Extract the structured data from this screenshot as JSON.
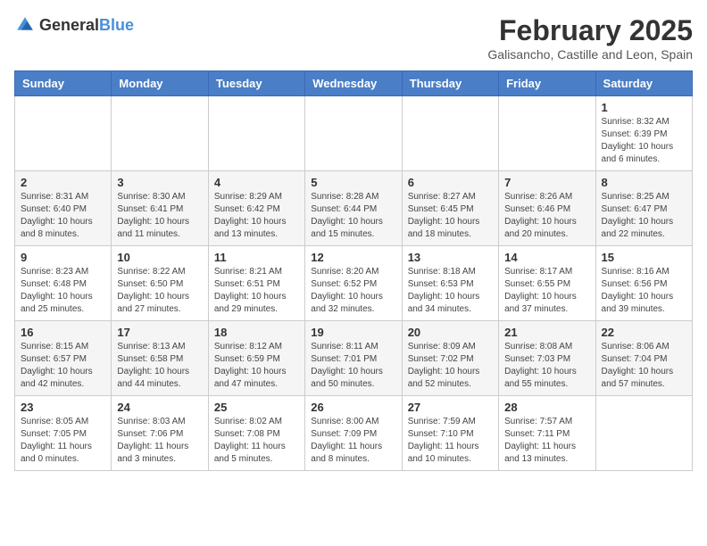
{
  "header": {
    "logo_general": "General",
    "logo_blue": "Blue",
    "month_year": "February 2025",
    "location": "Galisancho, Castille and Leon, Spain"
  },
  "days_of_week": [
    "Sunday",
    "Monday",
    "Tuesday",
    "Wednesday",
    "Thursday",
    "Friday",
    "Saturday"
  ],
  "weeks": [
    [
      {
        "day": "",
        "info": ""
      },
      {
        "day": "",
        "info": ""
      },
      {
        "day": "",
        "info": ""
      },
      {
        "day": "",
        "info": ""
      },
      {
        "day": "",
        "info": ""
      },
      {
        "day": "",
        "info": ""
      },
      {
        "day": "1",
        "info": "Sunrise: 8:32 AM\nSunset: 6:39 PM\nDaylight: 10 hours and 6 minutes."
      }
    ],
    [
      {
        "day": "2",
        "info": "Sunrise: 8:31 AM\nSunset: 6:40 PM\nDaylight: 10 hours and 8 minutes."
      },
      {
        "day": "3",
        "info": "Sunrise: 8:30 AM\nSunset: 6:41 PM\nDaylight: 10 hours and 11 minutes."
      },
      {
        "day": "4",
        "info": "Sunrise: 8:29 AM\nSunset: 6:42 PM\nDaylight: 10 hours and 13 minutes."
      },
      {
        "day": "5",
        "info": "Sunrise: 8:28 AM\nSunset: 6:44 PM\nDaylight: 10 hours and 15 minutes."
      },
      {
        "day": "6",
        "info": "Sunrise: 8:27 AM\nSunset: 6:45 PM\nDaylight: 10 hours and 18 minutes."
      },
      {
        "day": "7",
        "info": "Sunrise: 8:26 AM\nSunset: 6:46 PM\nDaylight: 10 hours and 20 minutes."
      },
      {
        "day": "8",
        "info": "Sunrise: 8:25 AM\nSunset: 6:47 PM\nDaylight: 10 hours and 22 minutes."
      }
    ],
    [
      {
        "day": "9",
        "info": "Sunrise: 8:23 AM\nSunset: 6:48 PM\nDaylight: 10 hours and 25 minutes."
      },
      {
        "day": "10",
        "info": "Sunrise: 8:22 AM\nSunset: 6:50 PM\nDaylight: 10 hours and 27 minutes."
      },
      {
        "day": "11",
        "info": "Sunrise: 8:21 AM\nSunset: 6:51 PM\nDaylight: 10 hours and 29 minutes."
      },
      {
        "day": "12",
        "info": "Sunrise: 8:20 AM\nSunset: 6:52 PM\nDaylight: 10 hours and 32 minutes."
      },
      {
        "day": "13",
        "info": "Sunrise: 8:18 AM\nSunset: 6:53 PM\nDaylight: 10 hours and 34 minutes."
      },
      {
        "day": "14",
        "info": "Sunrise: 8:17 AM\nSunset: 6:55 PM\nDaylight: 10 hours and 37 minutes."
      },
      {
        "day": "15",
        "info": "Sunrise: 8:16 AM\nSunset: 6:56 PM\nDaylight: 10 hours and 39 minutes."
      }
    ],
    [
      {
        "day": "16",
        "info": "Sunrise: 8:15 AM\nSunset: 6:57 PM\nDaylight: 10 hours and 42 minutes."
      },
      {
        "day": "17",
        "info": "Sunrise: 8:13 AM\nSunset: 6:58 PM\nDaylight: 10 hours and 44 minutes."
      },
      {
        "day": "18",
        "info": "Sunrise: 8:12 AM\nSunset: 6:59 PM\nDaylight: 10 hours and 47 minutes."
      },
      {
        "day": "19",
        "info": "Sunrise: 8:11 AM\nSunset: 7:01 PM\nDaylight: 10 hours and 50 minutes."
      },
      {
        "day": "20",
        "info": "Sunrise: 8:09 AM\nSunset: 7:02 PM\nDaylight: 10 hours and 52 minutes."
      },
      {
        "day": "21",
        "info": "Sunrise: 8:08 AM\nSunset: 7:03 PM\nDaylight: 10 hours and 55 minutes."
      },
      {
        "day": "22",
        "info": "Sunrise: 8:06 AM\nSunset: 7:04 PM\nDaylight: 10 hours and 57 minutes."
      }
    ],
    [
      {
        "day": "23",
        "info": "Sunrise: 8:05 AM\nSunset: 7:05 PM\nDaylight: 11 hours and 0 minutes."
      },
      {
        "day": "24",
        "info": "Sunrise: 8:03 AM\nSunset: 7:06 PM\nDaylight: 11 hours and 3 minutes."
      },
      {
        "day": "25",
        "info": "Sunrise: 8:02 AM\nSunset: 7:08 PM\nDaylight: 11 hours and 5 minutes."
      },
      {
        "day": "26",
        "info": "Sunrise: 8:00 AM\nSunset: 7:09 PM\nDaylight: 11 hours and 8 minutes."
      },
      {
        "day": "27",
        "info": "Sunrise: 7:59 AM\nSunset: 7:10 PM\nDaylight: 11 hours and 10 minutes."
      },
      {
        "day": "28",
        "info": "Sunrise: 7:57 AM\nSunset: 7:11 PM\nDaylight: 11 hours and 13 minutes."
      },
      {
        "day": "",
        "info": ""
      }
    ]
  ]
}
